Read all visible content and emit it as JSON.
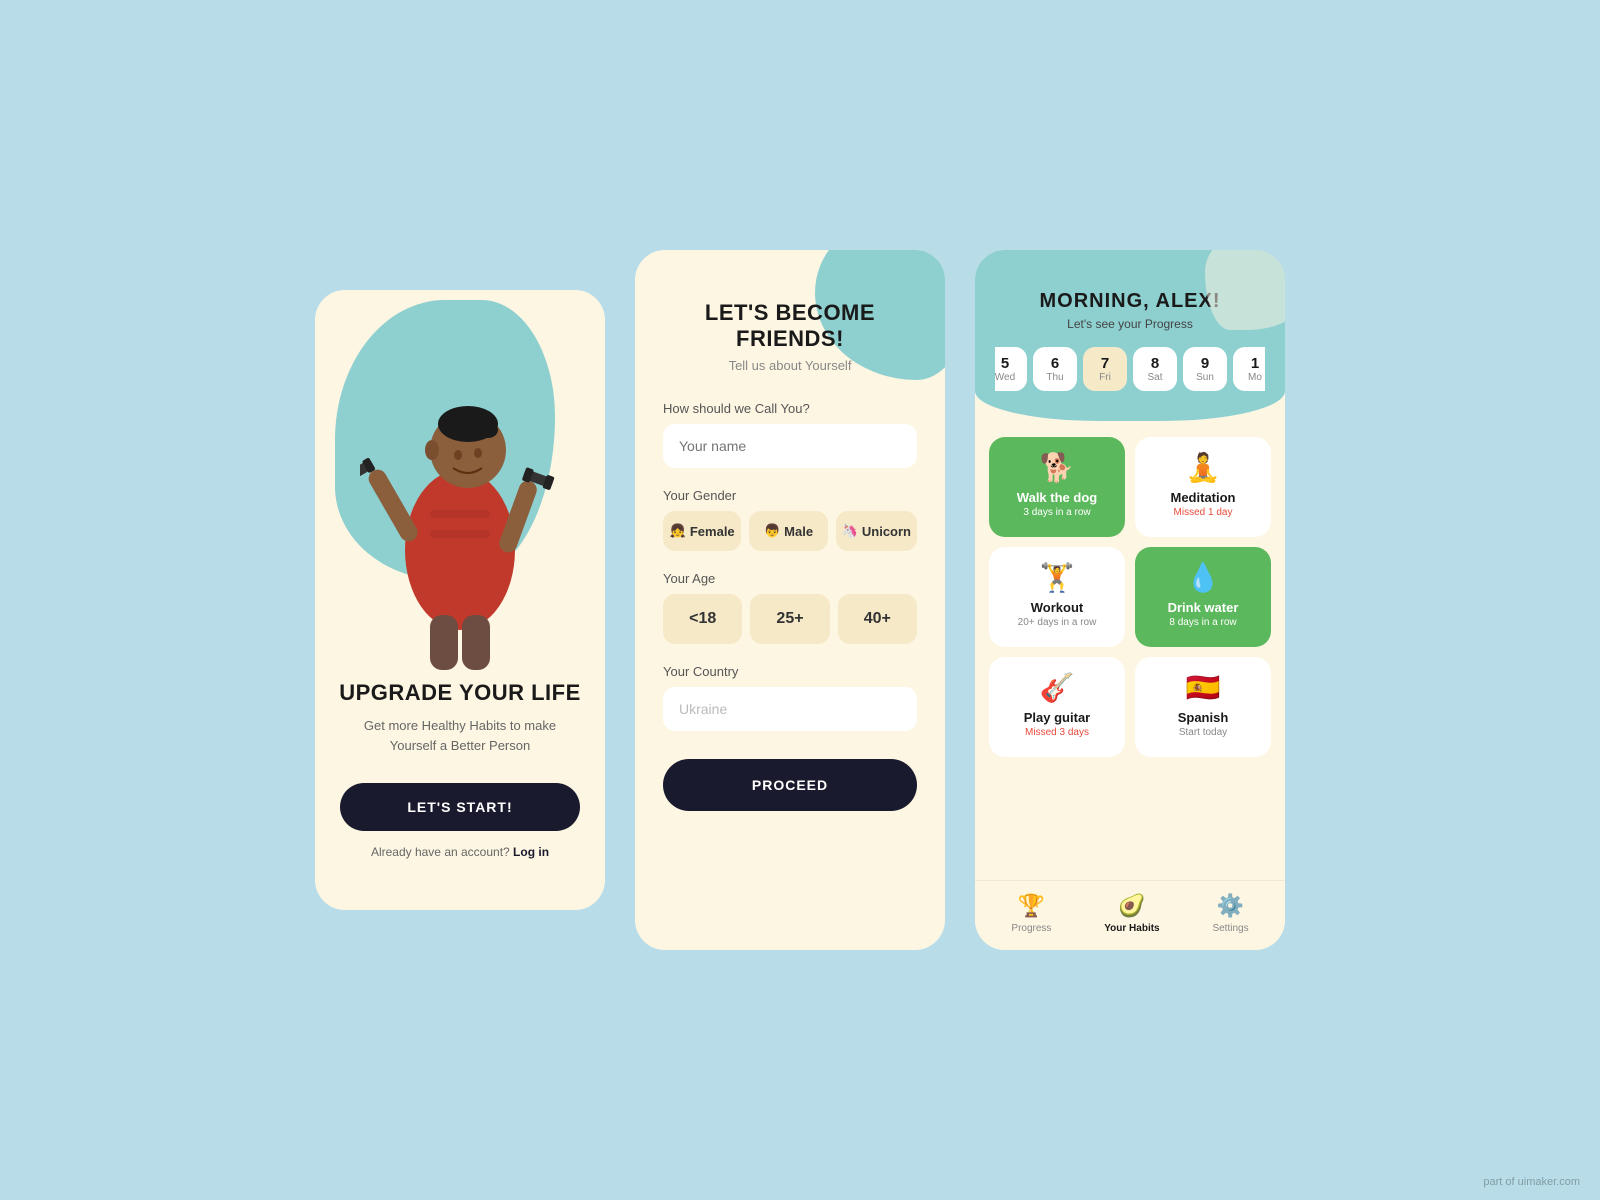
{
  "screen1": {
    "title": "UPGRADE YOUR LIFE",
    "subtitle": "Get more Healthy Habits to make Yourself a Better Person",
    "btn_start": "LET'S START!",
    "login_prompt": "Already have an account?",
    "login_link": "Log in"
  },
  "screen2": {
    "title": "LET'S BECOME FRIENDS!",
    "subtitle": "Tell us about Yourself",
    "name_label": "How should we Call You?",
    "name_placeholder": "Your name",
    "gender_label": "Your Gender",
    "genders": [
      {
        "icon": "👧",
        "label": "Female"
      },
      {
        "icon": "👦",
        "label": "Male"
      },
      {
        "icon": "🦄",
        "label": "Unicorn"
      }
    ],
    "age_label": "Your Age",
    "ages": [
      "<18",
      "25+",
      "40+"
    ],
    "country_label": "Your Country",
    "country_value": "Ukraine",
    "btn_proceed": "PROCEED"
  },
  "screen3": {
    "greeting": "MORNING, ALEX!",
    "progress_label": "Let's see your Progress",
    "dates": [
      {
        "num": "5",
        "day": "Wed",
        "active": false
      },
      {
        "num": "6",
        "day": "Thu",
        "active": false
      },
      {
        "num": "7",
        "day": "Fri",
        "active": true
      },
      {
        "num": "8",
        "day": "Sat",
        "active": false
      },
      {
        "num": "9",
        "day": "Sun",
        "active": false
      },
      {
        "num": "1",
        "day": "Mo",
        "active": false
      }
    ],
    "habits": [
      {
        "icon": "🐕",
        "name": "Walk the dog",
        "streak": "3 days in a row",
        "style": "green",
        "streak_color": "white"
      },
      {
        "icon": "🧘",
        "name": "Meditation",
        "streak": "Missed 1 day",
        "style": "normal",
        "streak_color": "red"
      },
      {
        "icon": "🏋️",
        "name": "Workout",
        "streak": "20+ days in a row",
        "style": "normal",
        "streak_color": "normal"
      },
      {
        "icon": "💧",
        "name": "Drink water",
        "streak": "8 days in a row",
        "style": "green",
        "streak_color": "white"
      },
      {
        "icon": "🎸",
        "name": "Play guitar",
        "streak": "Missed 3 days",
        "style": "normal",
        "streak_color": "red"
      },
      {
        "icon": "🇪🇸",
        "name": "Spanish",
        "streak": "Start today",
        "style": "normal",
        "streak_color": "normal"
      }
    ],
    "nav": [
      {
        "icon": "🏆",
        "label": "Progress",
        "active": false
      },
      {
        "icon": "🥑",
        "label": "Your Habits",
        "active": true
      },
      {
        "icon": "⚙️",
        "label": "Settings",
        "active": false
      }
    ]
  },
  "watermark": "part of uimaker.com"
}
